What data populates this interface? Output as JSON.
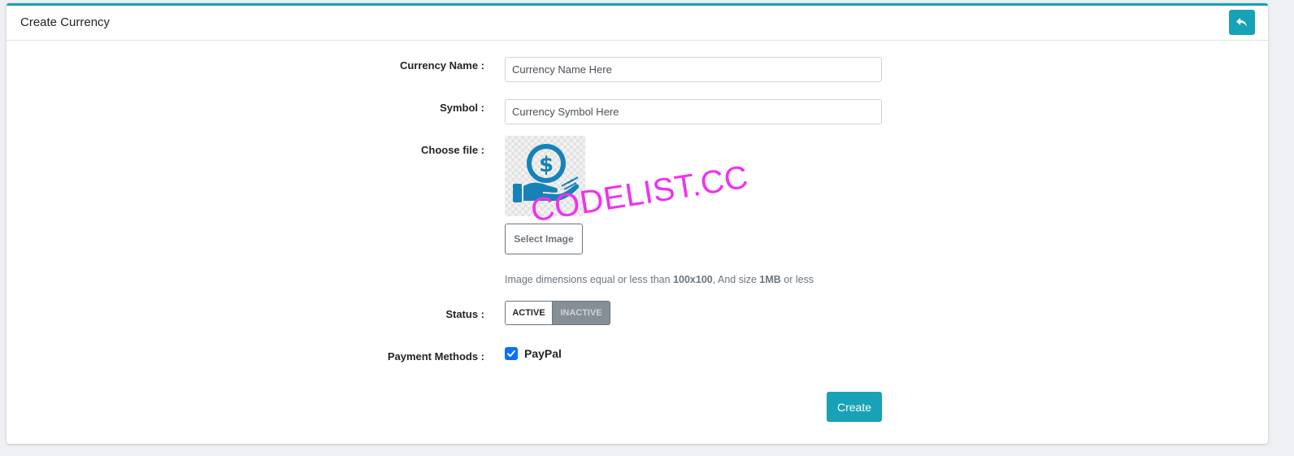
{
  "header": {
    "title": "Create Currency",
    "back_icon": "reply-arrow-icon"
  },
  "form": {
    "currency_name": {
      "label": "Currency Name :",
      "placeholder": "Currency Name Here",
      "value": ""
    },
    "symbol": {
      "label": "Symbol :",
      "placeholder": "Currency Symbol Here",
      "value": ""
    },
    "file": {
      "label": "Choose file :",
      "preview_icon": "hand-holding-dollar-icon",
      "button_label": "Select Image",
      "hint_prefix": "Image dimensions equal or less than ",
      "hint_dimensions": "100x100",
      "hint_middle": ", And size ",
      "hint_size": "1MB",
      "hint_suffix": " or less"
    },
    "status": {
      "label": "Status :",
      "active_label": "ACTIVE",
      "inactive_label": "INACTIVE",
      "selected": "ACTIVE"
    },
    "payment_methods": {
      "label": "Payment Methods :",
      "options": [
        {
          "label": "PayPal",
          "checked": true
        }
      ]
    },
    "submit_label": "Create"
  },
  "watermark": "CODELIST.CC",
  "colors": {
    "accent": "#17a2b8",
    "checkbox": "#0d6efd",
    "icon": "#1682b8",
    "watermark": "#ee33ee"
  }
}
